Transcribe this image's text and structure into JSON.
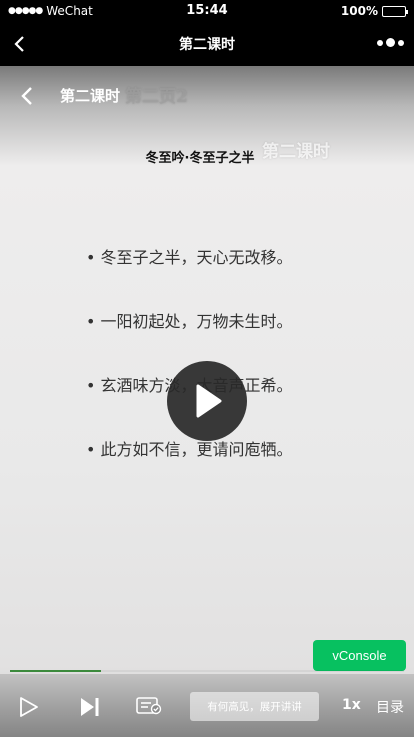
{
  "status_bar": {
    "carrier": "WeChat",
    "time": "15:44",
    "battery": "100%",
    "battery_level": 1.0
  },
  "nav": {
    "title": "第二课时"
  },
  "video": {
    "title": "第二课时",
    "watermark_page": "第二页2",
    "watermark_lesson": "第二课时",
    "poem_title": "冬至吟·冬至子之半",
    "lines": [
      "• 冬至子之半，天心无改移。",
      "• 一阳初起处，万物未生时。",
      "• 玄酒味方淡，大音声正希。",
      "• 此方如不信，更请问庖牺。"
    ],
    "progress_fraction": 0.23
  },
  "vconsole": {
    "label": "vConsole"
  },
  "controls": {
    "comment_placeholder": "有何高见，展开讲讲",
    "speed": "1x",
    "catalog": "目录"
  },
  "colors": {
    "accent_green": "#07c160",
    "progress_green": "#3c8a3c"
  }
}
